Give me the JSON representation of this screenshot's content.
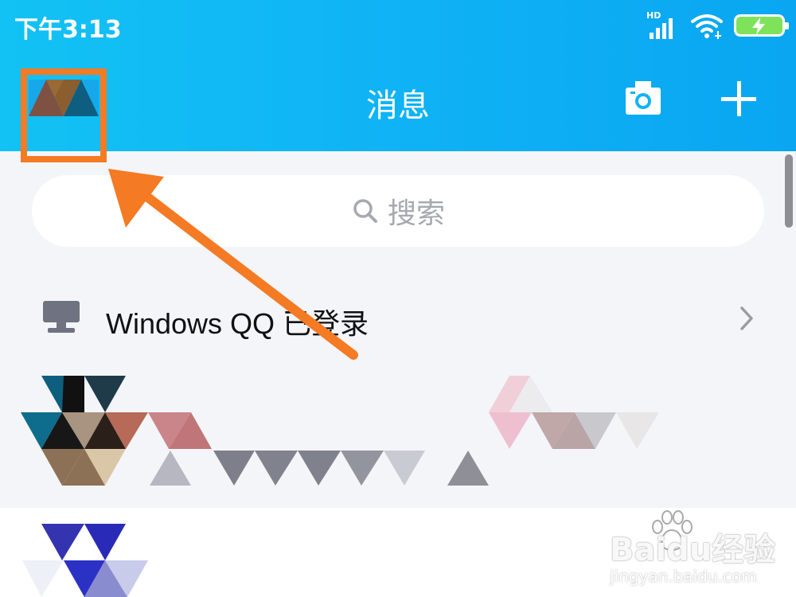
{
  "status_bar": {
    "time": "下午3:13",
    "network_label": "HD",
    "icons": [
      "signal-icon",
      "wifi-icon",
      "battery-charging-icon"
    ]
  },
  "header": {
    "title": "消息",
    "camera_icon": "camera-icon",
    "add_icon": "plus-icon",
    "background": "#10b4f5"
  },
  "search": {
    "placeholder": "搜索",
    "icon": "search-icon"
  },
  "login_notice": {
    "text": "Windows QQ 已登录",
    "icon": "monitor-icon",
    "chevron": "chevron-right-icon"
  },
  "annotation": {
    "color": "#f47a24"
  },
  "watermark": {
    "brand": "Baidu经验",
    "url": "jingyan.baidu.com"
  }
}
